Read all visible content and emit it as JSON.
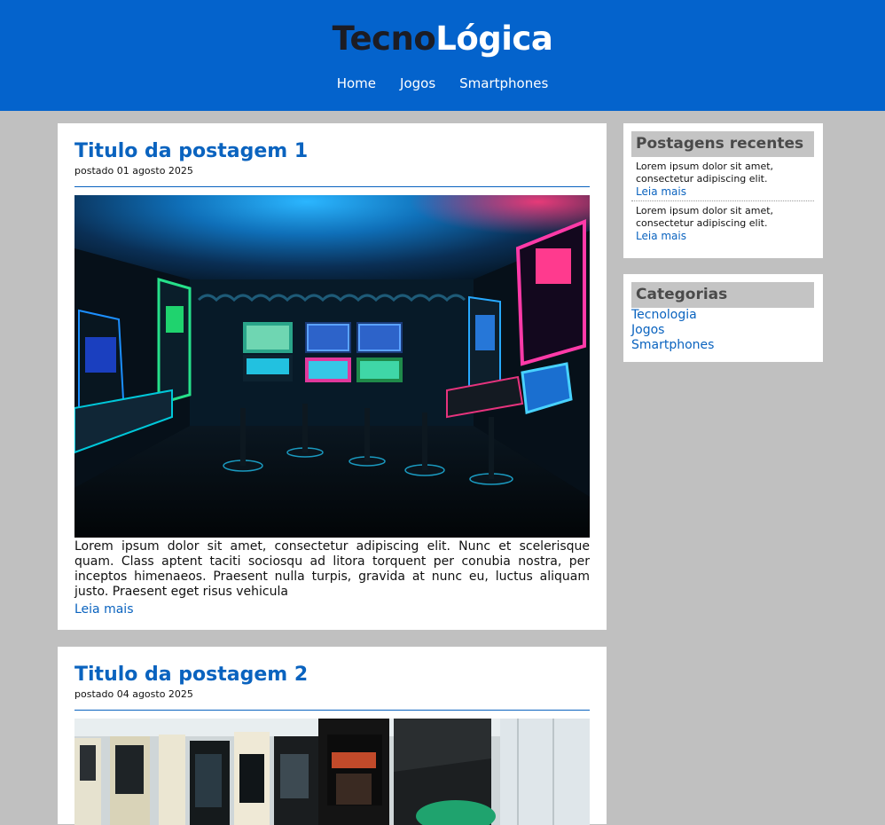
{
  "header": {
    "logo_part1": "Tecno",
    "logo_part2": "Lógica",
    "nav": [
      "Home",
      "Jogos",
      "Smartphones"
    ]
  },
  "posts": [
    {
      "title": "Titulo da postagem 1",
      "date": "postado 01 agosto 2025",
      "image": "arcade-room-photo",
      "body": "Lorem ipsum dolor sit amet, consectetur adipiscing elit. Nunc et scelerisque quam. Class aptent taciti sociosqu ad litora torquent per conubia nostra, per inceptos himenaeos. Praesent nulla turpis, gravida at nunc eu, luctus aliquam justo. Praesent eget risus vehicula",
      "read_more": "Leia mais"
    },
    {
      "title": "Titulo da postagem 2",
      "date": "postado 04 agosto 2025",
      "image": "retro-arcade-cabinets-photo"
    }
  ],
  "sidebar": {
    "recent": {
      "title": "Postagens recentes",
      "items": [
        {
          "text": "Lorem ipsum dolor sit amet, consectetur adipiscing elit.",
          "link": "Leia mais"
        },
        {
          "text": "Lorem ipsum dolor sit amet, consectetur adipiscing elit.",
          "link": "Leia mais"
        }
      ]
    },
    "categories": {
      "title": "Categorias",
      "items": [
        "Tecnologia",
        "Jogos",
        "Smartphones"
      ]
    }
  },
  "colors": {
    "header_bg": "#0463cc",
    "link": "#0a63bf",
    "page_bg": "#c0c0c0",
    "widget_title_bg": "#c4c4c4"
  }
}
